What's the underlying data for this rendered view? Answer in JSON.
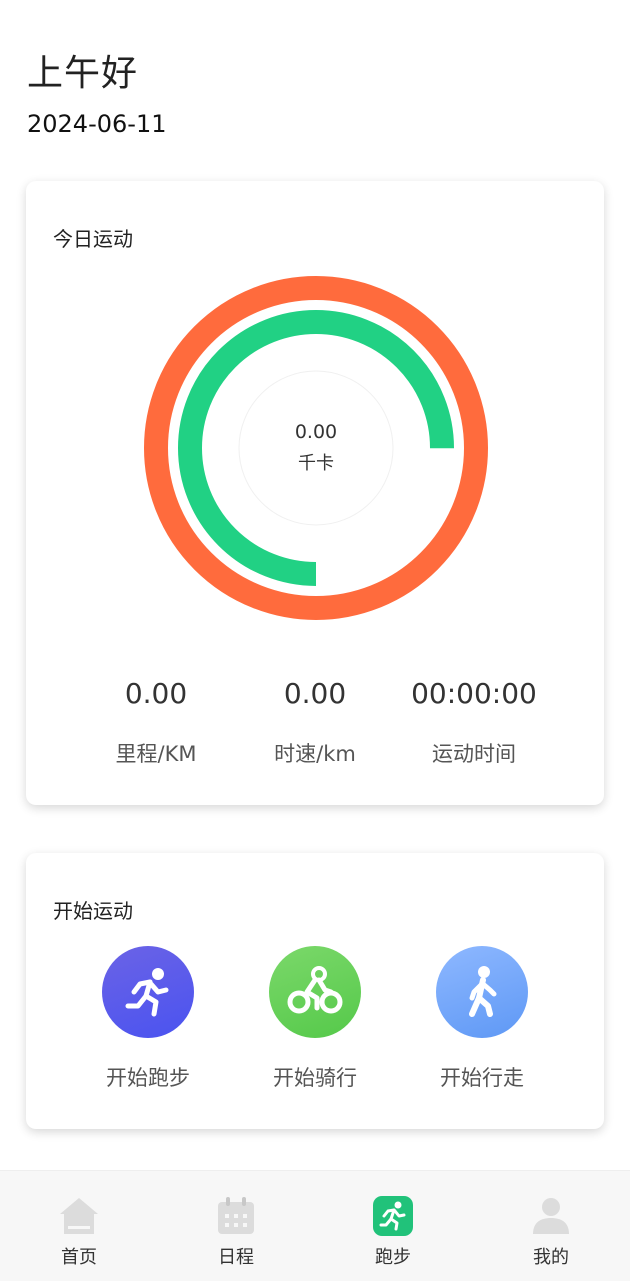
{
  "header": {
    "greeting": "上午好",
    "date": "2024-06-11"
  },
  "today": {
    "title": "今日运动",
    "calories_value": "0.00",
    "calories_unit": "千卡",
    "outer_ring_progress": 1.0,
    "inner_ring_progress": 0.75,
    "stats": [
      {
        "value": "0.00",
        "label": "里程/KM"
      },
      {
        "value": "0.00",
        "label": "时速/km"
      },
      {
        "value": "00:00:00",
        "label": "运动时间"
      }
    ],
    "colors": {
      "outer_ring": "#FF6B3D",
      "inner_ring": "#21D184"
    }
  },
  "start": {
    "title": "开始运动",
    "actions": [
      {
        "label": "开始跑步",
        "icon": "running-icon"
      },
      {
        "label": "开始骑行",
        "icon": "cycling-icon"
      },
      {
        "label": "开始行走",
        "icon": "walking-icon"
      }
    ]
  },
  "tabbar": {
    "items": [
      {
        "label": "首页",
        "icon": "home-icon"
      },
      {
        "label": "日程",
        "icon": "calendar-icon"
      },
      {
        "label": "跑步",
        "icon": "running-icon",
        "active": true
      },
      {
        "label": "我的",
        "icon": "user-icon"
      }
    ],
    "active_color": "#21C27A"
  }
}
